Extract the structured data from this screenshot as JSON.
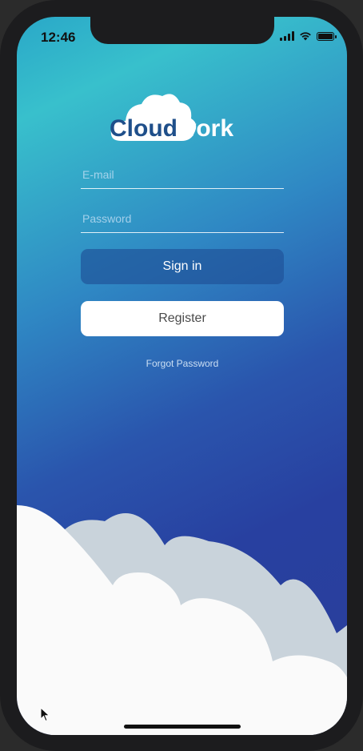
{
  "status_bar": {
    "time": "12:46"
  },
  "logo": {
    "part1": "Cloud",
    "part2": "work"
  },
  "form": {
    "email_placeholder": "E-mail",
    "password_placeholder": "Password",
    "signin_label": "Sign in",
    "register_label": "Register",
    "forgot_label": "Forgot Password"
  },
  "colors": {
    "gradient_top": "#38c0cc",
    "gradient_bottom": "#2a3e9a",
    "signin_button": "#2f5a9a",
    "register_button": "#ffffff",
    "cloud_front": "#fafafa",
    "cloud_back": "#c9d3db"
  }
}
